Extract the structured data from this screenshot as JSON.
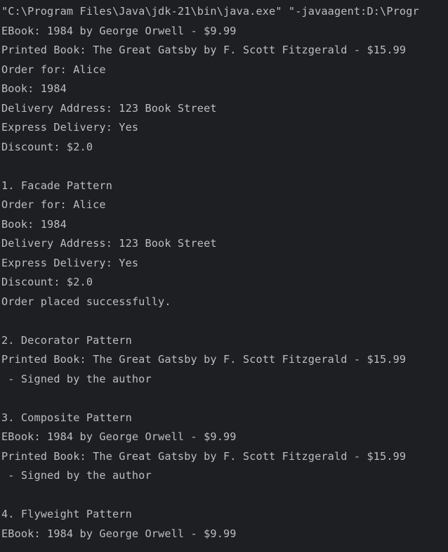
{
  "console": {
    "lines": [
      "\"C:\\Program Files\\Java\\jdk-21\\bin\\java.exe\" \"-javaagent:D:\\Progr",
      "EBook: 1984 by George Orwell - $9.99",
      "Printed Book: The Great Gatsby by F. Scott Fitzgerald - $15.99",
      "Order for: Alice",
      "Book: 1984",
      "Delivery Address: 123 Book Street",
      "Express Delivery: Yes",
      "Discount: $2.0",
      "",
      "1. Facade Pattern",
      "Order for: Alice",
      "Book: 1984",
      "Delivery Address: 123 Book Street",
      "Express Delivery: Yes",
      "Discount: $2.0",
      "Order placed successfully.",
      "",
      "2. Decorator Pattern",
      "Printed Book: The Great Gatsby by F. Scott Fitzgerald - $15.99",
      " - Signed by the author",
      "",
      "3. Composite Pattern",
      "EBook: 1984 by George Orwell - $9.99",
      "Printed Book: The Great Gatsby by F. Scott Fitzgerald - $15.99",
      " - Signed by the author",
      "",
      "4. Flyweight Pattern",
      "EBook: 1984 by George Orwell - $9.99"
    ]
  }
}
